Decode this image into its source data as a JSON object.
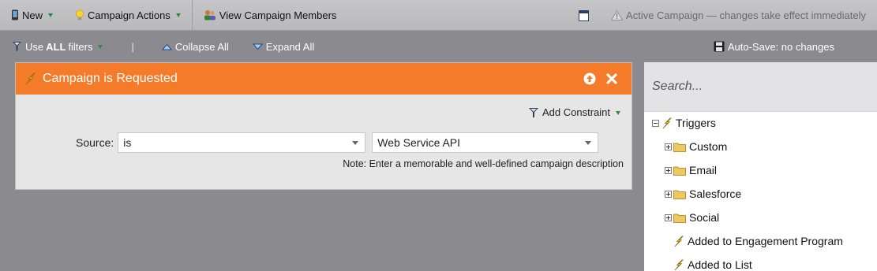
{
  "toolbar": {
    "new_label": "New",
    "campaign_actions_label": "Campaign Actions",
    "view_members_label": "View Campaign Members",
    "status_text": "Active Campaign — changes take effect immediately"
  },
  "subtoolbar": {
    "use_label_prefix": "Use",
    "use_label_bold": "ALL",
    "use_label_suffix": "filters",
    "separator": "|",
    "collapse_label": "Collapse All",
    "expand_label": "Expand All",
    "autosave_label": "Auto-Save: no changes"
  },
  "filter": {
    "title": "Campaign is Requested",
    "add_constraint_label": "Add Constraint",
    "source_label": "Source:",
    "operator_value": "is",
    "source_value": "Web Service API",
    "note": "Note: Enter a memorable and well-defined campaign description"
  },
  "sidebar": {
    "search_placeholder": "Search...",
    "tree": [
      {
        "label": "Triggers",
        "kind": "root",
        "expander": "minus"
      },
      {
        "label": "Custom",
        "kind": "folder",
        "expander": "plus"
      },
      {
        "label": "Email",
        "kind": "folder",
        "expander": "plus"
      },
      {
        "label": "Salesforce",
        "kind": "folder",
        "expander": "plus"
      },
      {
        "label": "Social",
        "kind": "folder",
        "expander": "plus"
      },
      {
        "label": "Added to Engagement Program",
        "kind": "trigger",
        "expander": ""
      },
      {
        "label": "Added to List",
        "kind": "trigger",
        "expander": ""
      }
    ]
  },
  "colors": {
    "header_orange": "#f47b2a",
    "toolbar_gray": "#c0c0c2",
    "canvas_gray": "#8a8a8f",
    "accent_green": "#2e8b3a"
  },
  "icons": {
    "new": "mobile-icon",
    "campaign_actions": "lightbulb-icon",
    "view_members": "people-icon",
    "window": "window-icon",
    "warning": "warning-icon",
    "filters": "funnel-icon",
    "collapse": "collapse-icon",
    "expand": "expand-icon",
    "save": "floppy-disk-icon",
    "trigger": "lightning-icon",
    "folder": "folder-icon"
  }
}
